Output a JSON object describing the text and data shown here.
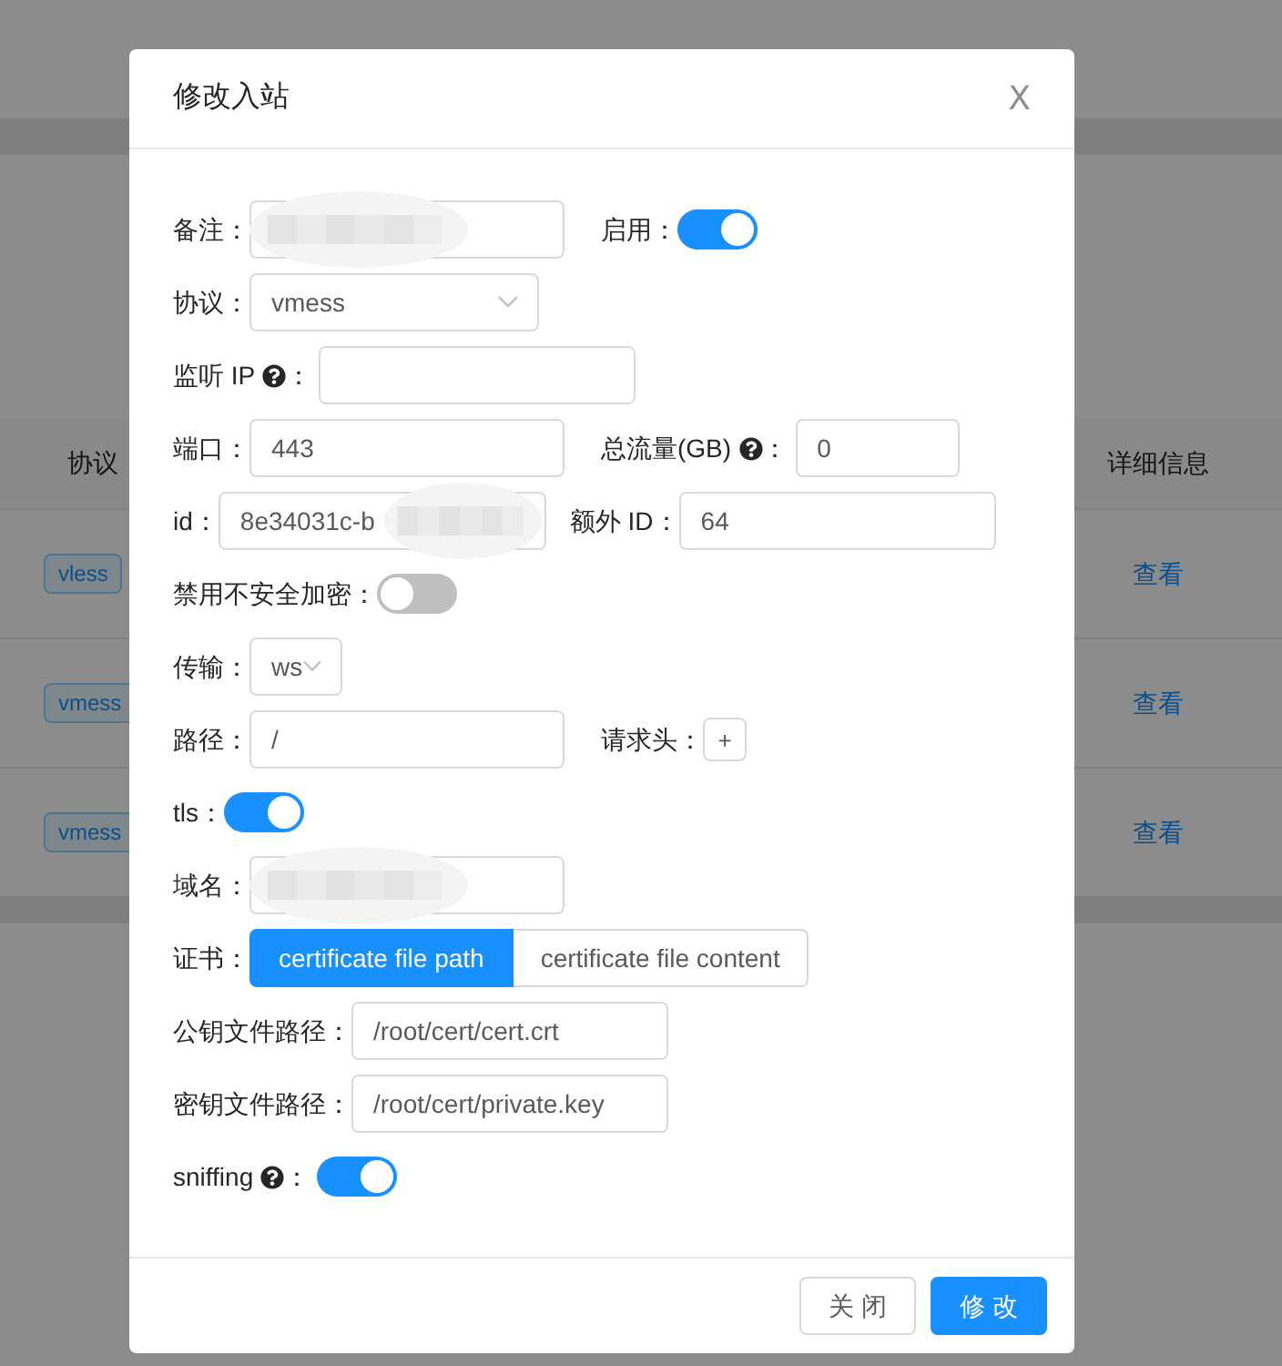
{
  "background": {
    "columns": [
      {
        "label": "协议"
      },
      {
        "label": "详细信息"
      }
    ],
    "rows": [
      {
        "protocol": "vless",
        "action": "查看"
      },
      {
        "protocol": "vmess",
        "action": "查看"
      },
      {
        "protocol": "vmess",
        "action": "查看"
      }
    ]
  },
  "dialog": {
    "title": "修改入站",
    "close": "X",
    "rows": [
      [
        {
          "kind": "input",
          "label": "备注：",
          "redacted": true
        },
        {
          "kind": "switch",
          "label": "启用：",
          "on": true
        }
      ],
      [
        {
          "kind": "select",
          "label": "协议：",
          "value": "vmess"
        }
      ],
      [
        {
          "kind": "input",
          "label": "监听 IP",
          "help": true,
          "colon": "："
        }
      ],
      [
        {
          "kind": "input",
          "label": "端口：",
          "value": "443"
        },
        {
          "kind": "input",
          "label": "总流量(GB)",
          "help": true,
          "colon": "：",
          "value": "0"
        }
      ],
      [
        {
          "kind": "input",
          "label": "id：",
          "value": "8e34031c-b",
          "redacted": true
        },
        {
          "kind": "input",
          "label": "额外 ID：",
          "value": "64"
        }
      ],
      [
        {
          "kind": "switch",
          "label": "禁用不安全加密：",
          "on": false
        }
      ],
      [
        {
          "kind": "select",
          "label": "传输：",
          "value": "ws"
        }
      ],
      [
        {
          "kind": "input",
          "label": "路径：",
          "value": "/"
        },
        {
          "kind": "add",
          "label": "请求头：",
          "value": "+"
        }
      ],
      [
        {
          "kind": "switch",
          "label": "tls：",
          "on": true
        }
      ],
      [
        {
          "kind": "input",
          "label": "域名：",
          "redacted": true
        }
      ],
      [
        {
          "kind": "segmented",
          "label": "证书：",
          "options": [
            {
              "label": "certificate file path",
              "selected": true
            },
            {
              "label": "certificate file content",
              "selected": false
            }
          ]
        }
      ],
      [
        {
          "kind": "input",
          "label": "公钥文件路径：",
          "value": "/root/cert/cert.crt"
        }
      ],
      [
        {
          "kind": "input",
          "label": "密钥文件路径：",
          "value": "/root/cert/private.key"
        }
      ],
      [
        {
          "kind": "switch",
          "label": "sniffing",
          "help": true,
          "colon": "：",
          "on": true
        }
      ]
    ],
    "buttons": [
      {
        "label": "关 闭",
        "kind": "default"
      },
      {
        "label": "修 改",
        "kind": "primary"
      }
    ]
  }
}
